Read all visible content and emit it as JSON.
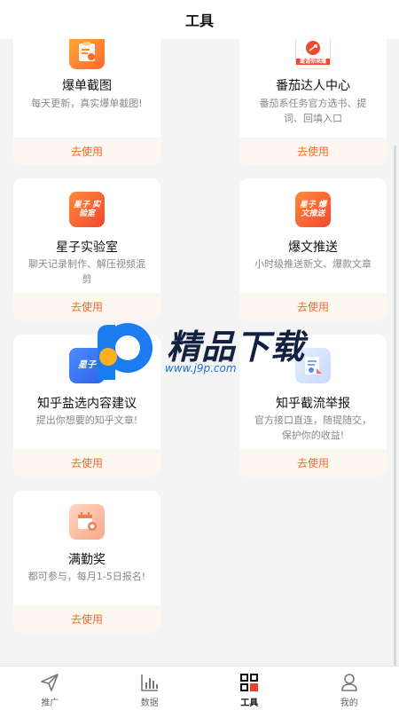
{
  "header": {
    "title": "工具"
  },
  "cards": [
    {
      "name": "爆单截图",
      "desc": "每天更新，真实爆单截图!",
      "action": "去使用",
      "icon": "clipboard-icon"
    },
    {
      "name": "番茄达人中心",
      "desc": "番茄系任务官方选书、提词、回填入口",
      "action": "去使用",
      "icon": "tomato-talent-icon",
      "icon_text": "邀请你来赚"
    },
    {
      "name": "星子实验室",
      "desc": "聊天记录制作、解压视频混剪",
      "action": "去使用",
      "icon": "xingzi-lab-icon",
      "icon_text": "星子 实验室"
    },
    {
      "name": "爆文推送",
      "desc": "小时级推送新文、爆款文章",
      "action": "去使用",
      "icon": "hot-article-icon",
      "icon_text": "星子 爆文推送"
    },
    {
      "name": "知乎盐选内容建议",
      "desc": "提出你想要的知乎文章!",
      "action": "去使用",
      "icon": "zhihu-suggest-icon",
      "icon_text": "星子"
    },
    {
      "name": "知乎截流举报",
      "desc": "官方接口直连，随提随交，保护你的收益!",
      "action": "去使用",
      "icon": "report-icon"
    },
    {
      "name": "满勤奖",
      "desc": "都可参与，每月1-5日报名!",
      "action": "去使用",
      "icon": "attendance-award-icon"
    }
  ],
  "watermark": {
    "title": "精品下载",
    "url": "www.j9p.com"
  },
  "tabbar": [
    {
      "label": "推广",
      "icon": "paper-plane-icon",
      "active": false
    },
    {
      "label": "数据",
      "icon": "bar-chart-icon",
      "active": false
    },
    {
      "label": "工具",
      "icon": "tools-grid-icon",
      "active": true
    },
    {
      "label": "我的",
      "icon": "profile-icon",
      "active": false
    }
  ],
  "colors": {
    "accent": "#f26b2b",
    "action_bg": "#fdf7f1",
    "active_tab": "#e8442b"
  }
}
